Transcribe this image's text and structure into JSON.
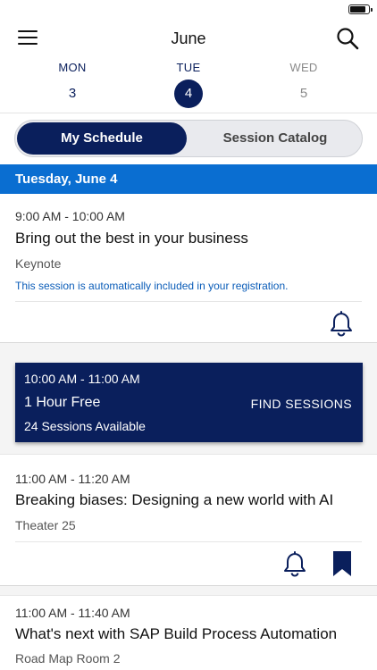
{
  "status_bar": {
    "battery_level": 0.9
  },
  "header": {
    "title": "June",
    "menu_icon": "hamburger-menu-icon",
    "search_icon": "search-icon"
  },
  "days": [
    {
      "dow": "MON",
      "num": "3"
    },
    {
      "dow": "TUE",
      "num": "4"
    },
    {
      "dow": "WED",
      "num": "5"
    }
  ],
  "tabs": {
    "my_schedule": "My Schedule",
    "session_catalog": "Session Catalog"
  },
  "date_header": "Tuesday, June 4",
  "sessions": [
    {
      "time": "9:00 AM - 10:00 AM",
      "title": "Bring out the best in your business",
      "location": "Keynote",
      "note": "This session is automatically included in your registration."
    },
    {
      "time": "11:00 AM - 11:20 AM",
      "title": "Breaking biases: Designing a new world with AI",
      "location": "Theater 25"
    },
    {
      "time": "11:00 AM - 11:40 AM",
      "title": "What's next with SAP Build Process Automation",
      "location": "Road Map Room 2"
    }
  ],
  "free_block": {
    "time": "10:00 AM - 11:00 AM",
    "label": "1 Hour Free",
    "count": "24 Sessions Available",
    "action": "FIND SESSIONS"
  },
  "colors": {
    "navy": "#0a1f5c",
    "blue": "#0a6ed1",
    "link": "#0a5cb8"
  }
}
